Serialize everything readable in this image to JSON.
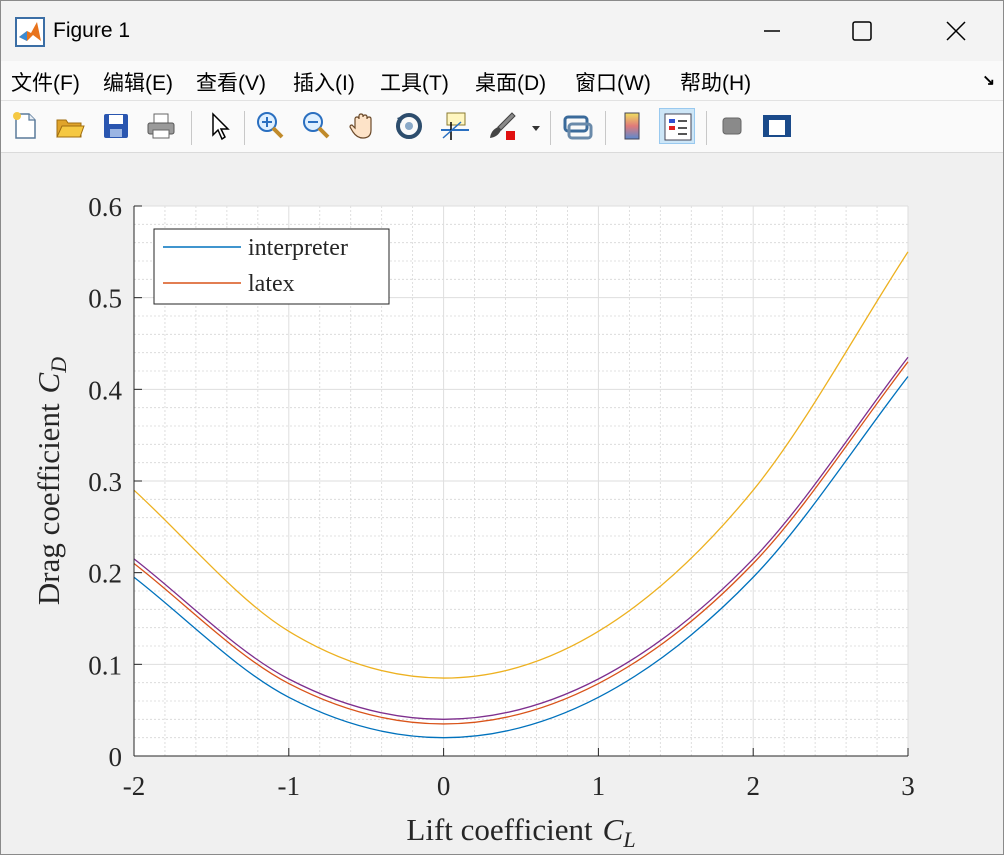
{
  "window": {
    "title": "Figure 1"
  },
  "menu": [
    "文件(F)",
    "编辑(E)",
    "查看(V)",
    "插入(I)",
    "工具(T)",
    "桌面(D)",
    "窗口(W)",
    "帮助(H)"
  ],
  "toolbar_icons": [
    "new-figure-icon",
    "open-file-icon",
    "save-icon",
    "print-icon",
    "edit-plot-icon",
    "zoom-in-icon",
    "zoom-out-icon",
    "pan-icon",
    "rotate-3d-icon",
    "data-cursor-icon",
    "brush-icon",
    "brush-dropdown-icon",
    "link-plot-icon",
    "colorbar-icon",
    "legend-icon",
    "hide-plot-tools-icon",
    "show-plot-tools-icon"
  ],
  "colors": {
    "blue": "#0072BD",
    "red": "#D95319",
    "yellow": "#EDB120",
    "purple": "#7E2F8E"
  },
  "chart_data": {
    "type": "line",
    "xlabel": "Lift coefficient",
    "xlabel_math": "C",
    "xlabel_sub": "L",
    "ylabel": "Drag coefficient",
    "ylabel_math": "C",
    "ylabel_sub": "D",
    "xlim": [
      -2,
      3
    ],
    "ylim": [
      0,
      0.6
    ],
    "xticks": [
      -2,
      -1,
      0,
      1,
      2,
      3
    ],
    "xtick_labels": [
      "-2",
      "-1",
      "0",
      "1",
      "2",
      "3"
    ],
    "yticks": [
      0,
      0.1,
      0.2,
      0.3,
      0.4,
      0.5,
      0.6
    ],
    "ytick_labels": [
      "0",
      "0.1",
      "0.2",
      "0.3",
      "0.4",
      "0.5",
      "0.6"
    ],
    "grid": true,
    "minor_grid": true,
    "legend_position": "top-left",
    "legend": [
      "interpreter",
      "latex"
    ],
    "series": [
      {
        "name": "interpreter",
        "color": "#0072BD",
        "x": [
          -2,
          -1,
          0,
          1,
          2,
          3
        ],
        "y": [
          0.195,
          0.064,
          0.02,
          0.064,
          0.195,
          0.414
        ]
      },
      {
        "name": "latex",
        "color": "#D95319",
        "x": [
          -2,
          -1,
          0,
          1,
          2,
          3
        ],
        "y": [
          0.21,
          0.079,
          0.035,
          0.079,
          0.21,
          0.43
        ]
      },
      {
        "color": "#EDB120",
        "x": [
          -2,
          -1,
          0,
          1,
          2,
          3
        ],
        "y": [
          0.29,
          0.136,
          0.085,
          0.136,
          0.29,
          0.55
        ]
      },
      {
        "color": "#7E2F8E",
        "x": [
          -2,
          -1,
          0,
          1,
          2,
          3
        ],
        "y": [
          0.215,
          0.084,
          0.04,
          0.084,
          0.215,
          0.435
        ]
      }
    ]
  }
}
